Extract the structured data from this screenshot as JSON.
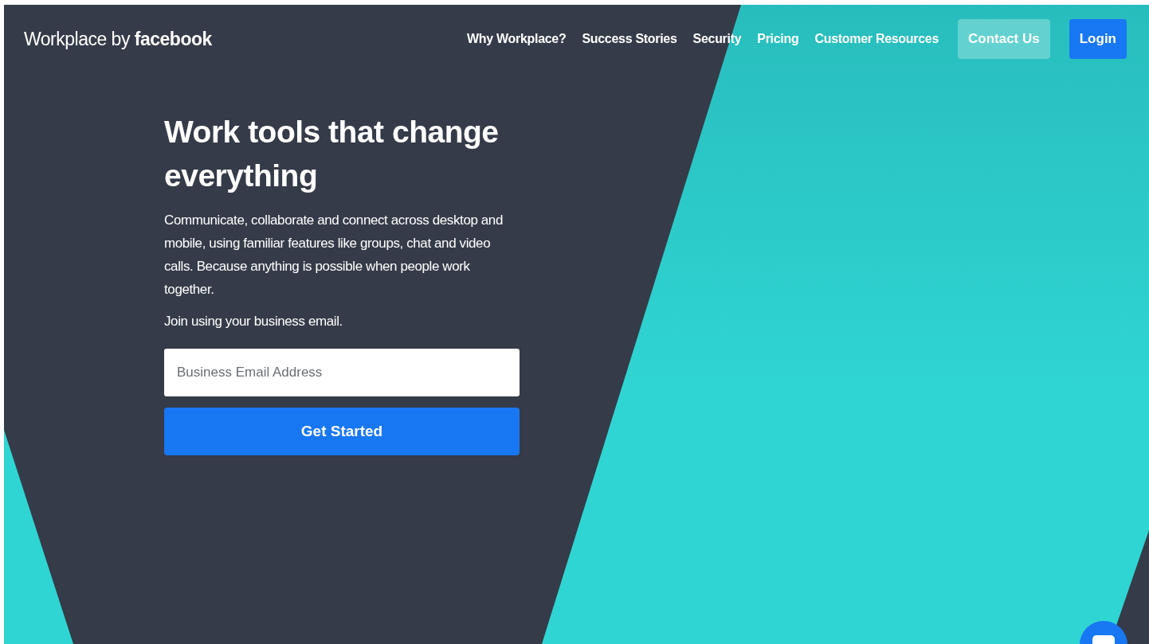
{
  "header": {
    "logo": "Workplace by **facebook**",
    "nav": [
      {
        "label": "Why Workplace?",
        "kind": "link"
      },
      {
        "label": "Success Stories",
        "kind": "link"
      },
      {
        "label": "Security",
        "kind": "link"
      },
      {
        "label": "Pricing",
        "kind": "link"
      },
      {
        "label": "Customer Resources",
        "kind": "link"
      },
      {
        "label": "Contact Us",
        "kind": "secondary"
      },
      {
        "label": "Login",
        "kind": "primary"
      }
    ]
  },
  "hero": {
    "headline": "Work tools that change everything",
    "description": "Communicate, collaborate and connect across desktop and mobile, using familiar features like groups, chat and video calls. Because anything is possible when people work together.",
    "prompt": "Join using your business email.",
    "email": {
      "placeholder": "Business Email Address"
    },
    "cta": "Get Started"
  }
}
